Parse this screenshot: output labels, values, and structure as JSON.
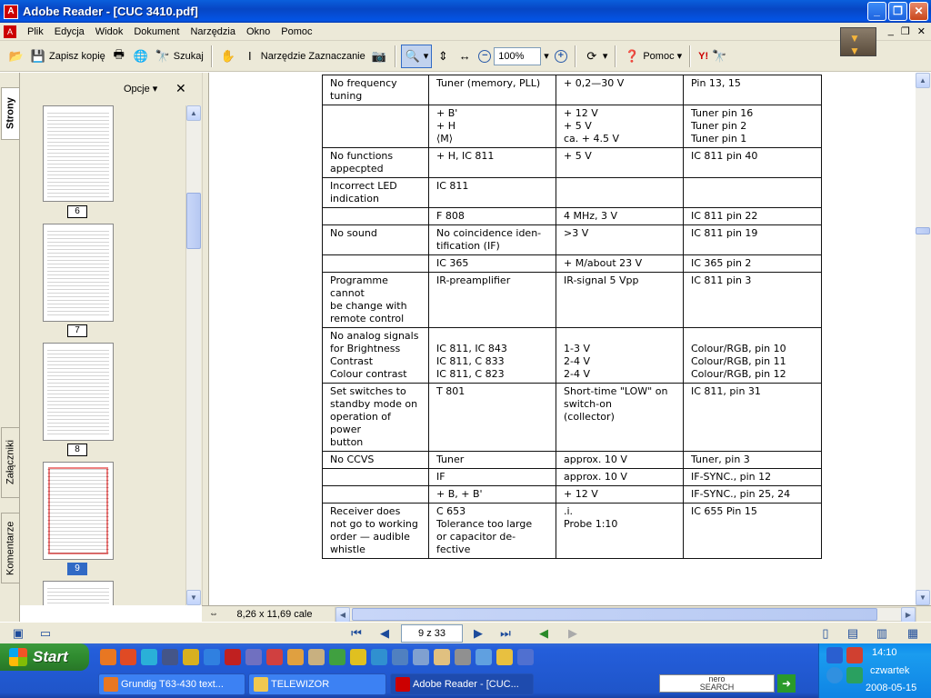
{
  "window": {
    "title": "Adobe Reader - [CUC 3410.pdf]",
    "min_label": "_",
    "max_label": "❐",
    "close_label": "✕"
  },
  "menu": {
    "items": [
      "Plik",
      "Edycja",
      "Widok",
      "Dokument",
      "Narzędzia",
      "Okno",
      "Pomoc"
    ],
    "mdi_min": "_",
    "mdi_restore": "❐",
    "mdi_close": "✕"
  },
  "toolbar": {
    "save_copy": "Zapisz kopię",
    "search": "Szukaj",
    "select_tool": "Narzędzie Zaznaczanie",
    "zoom_value": "100%",
    "help": "Pomoc",
    "yahoo": "Y!"
  },
  "side_tabs": {
    "pages": "Strony",
    "attachments": "Załączniki",
    "comments": "Komentarze"
  },
  "pages_panel": {
    "options": "Opcje ▾",
    "close": "✕",
    "thumbnails": [
      {
        "label": "6"
      },
      {
        "label": "7"
      },
      {
        "label": "8"
      },
      {
        "label": "9"
      }
    ]
  },
  "document": {
    "rows": [
      {
        "c1": "No frequency\ntuning",
        "c2": "Tuner (memory, PLL)",
        "c3": "+ 0,2—30  V",
        "c4": "Pin 13, 15"
      },
      {
        "c1": "",
        "c2": "+  B'\n+  H\n⟨M⟩",
        "c3": "+  12 V\n+  5 V\nca. +  4.5  V",
        "c4": "Tuner pin 16\nTuner pin 2\nTuner pin 1"
      },
      {
        "c1": "No functions\nappecpted",
        "c2": "+  H, IC 811",
        "c3": "+  5  V",
        "c4": "IC 811 pin 40"
      },
      {
        "c1": "Incorrect LED\nindication",
        "c2": "IC 811",
        "c3": "",
        "c4": ""
      },
      {
        "c1": "",
        "c2": "F  808",
        "c3": "4  MHz, 3  V",
        "c4": "IC 811 pin 22"
      },
      {
        "c1": "No sound",
        "c2": "No coincidence iden-\ntification (IF)",
        "c3": ">3  V",
        "c4": "IC 811 pin 19"
      },
      {
        "c1": "",
        "c2": "IC 365",
        "c3": "+  M/about 23  V",
        "c4": "IC 365 pin 2"
      },
      {
        "c1": "Programme cannot\nbe change with\nremote control",
        "c2": "IR-preamplifier",
        "c3": "IR-signal 5  Vpp",
        "c4": "IC 811 pin 3"
      },
      {
        "c1": "No analog signals\nfor Brightness\nContrast\nColour contrast",
        "c2": "\nIC 811, IC 843\nIC 811, C 833\nIC 811, C 823",
        "c3": "\n1-3 V\n2-4 V\n2-4 V",
        "c4": "\nColour/RGB, pin 10\nColour/RGB, pin 11\nColour/RGB, pin 12"
      },
      {
        "c1": "Set switches to\nstandby mode on\noperation of power\nbutton",
        "c2": "T 801",
        "c3": "Short-time \"LOW\" on\nswitch-on\n(collector)",
        "c4": "IC 811, pin 31"
      },
      {
        "c1": "No CCVS",
        "c2": "Tuner",
        "c3": "approx. 10 V",
        "c4": "Tuner, pin 3"
      },
      {
        "c1": "",
        "c2": "IF",
        "c3": "approx. 10 V",
        "c4": "IF-SYNC., pin 12"
      },
      {
        "c1": "",
        "c2": "+  B, +  B'",
        "c3": "+  12  V",
        "c4": "IF-SYNC., pin 25, 24"
      },
      {
        "c1": "Receiver does\nnot go to working\norder — audible\nwhistle",
        "c2": "C 653\nTolerance too large\nor capacitor de-\nfective",
        "c3": ".i.\nProbe 1:10",
        "c4": "IC 655 Pin 15"
      }
    ]
  },
  "status": {
    "page_size": "8,26 x 11,69 cale"
  },
  "nav": {
    "page_display": "9 z 33"
  },
  "taskbar": {
    "start": "Start",
    "tasks": [
      {
        "label": "Grundig T63-430 text..."
      },
      {
        "label": "TELEWIZOR"
      },
      {
        "label": "Adobe Reader - [CUC..."
      }
    ],
    "nero": "nero\nSEARCH",
    "clock": "14:10",
    "day": "czwartek",
    "date": "2008-05-15"
  }
}
